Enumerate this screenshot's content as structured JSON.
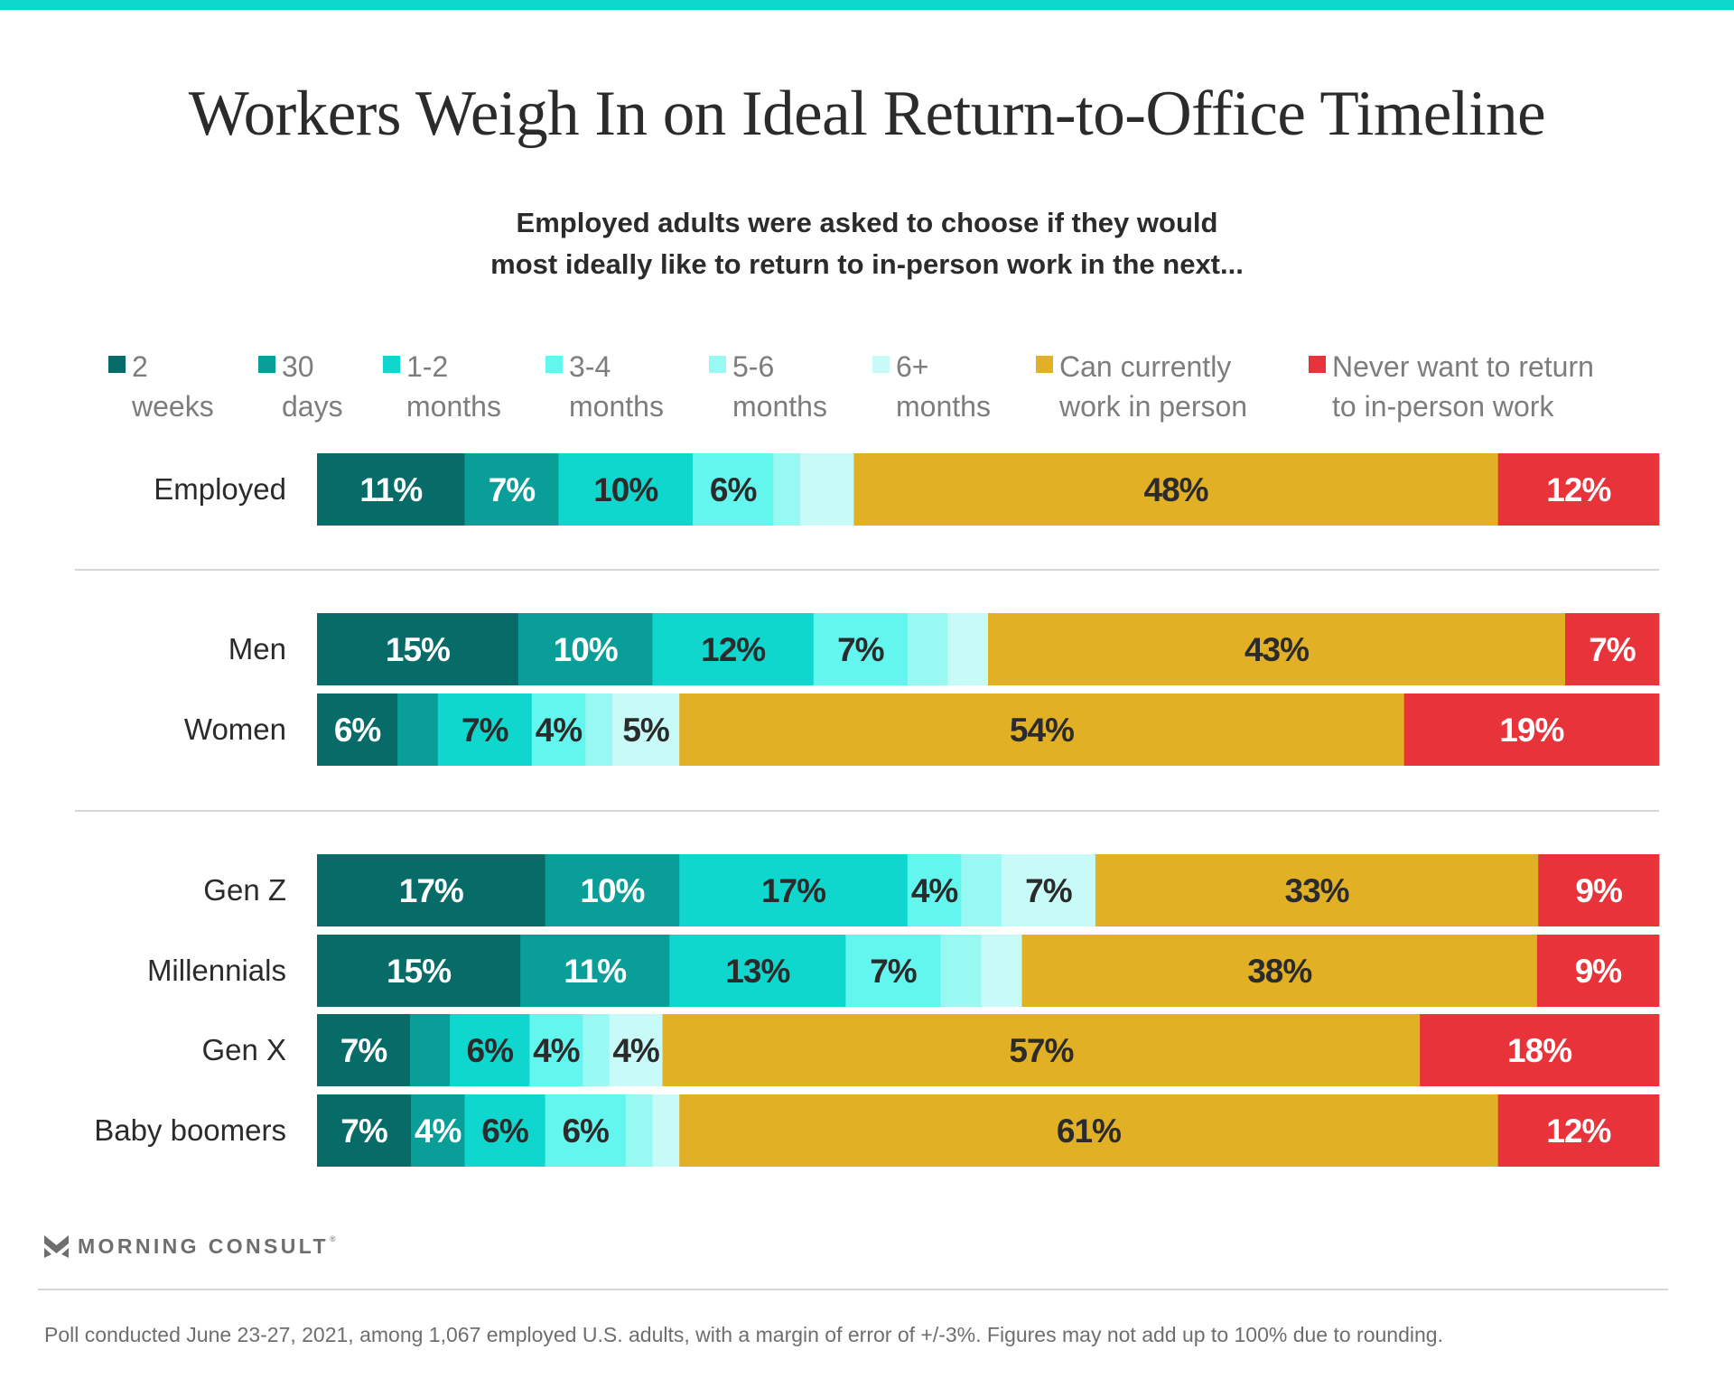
{
  "page": {
    "title": "Workers Weigh In on Ideal Return-to-Office Timeline",
    "subtitle_lines": [
      "Employed adults were asked to choose if they would",
      "most ideally like to return to in-person work in the next..."
    ],
    "brand": "MORNING CONSULT",
    "brand_mark": "®",
    "footnote": "Poll conducted June 23-27, 2021, among 1,067 employed U.S. adults, with a margin of error of +/-3%. Figures may not add up to 100% due to rounding.",
    "accent_color": "#0fd6cc"
  },
  "chart_data": {
    "type": "bar",
    "orientation": "horizontal",
    "stacked": true,
    "title": "Workers Weigh In on Ideal Return-to-Office Timeline",
    "subtitle": "Employed adults were asked to choose if they would most ideally like to return to in-person work in the next...",
    "xlabel": "",
    "ylabel": "",
    "units": "%",
    "xlim": [
      0,
      100
    ],
    "grid": false,
    "legend_position": "top",
    "categories": [
      "Employed",
      "Men",
      "Women",
      "Gen Z",
      "Millennials",
      "Gen X",
      "Baby boomers"
    ],
    "groups": [
      [
        "Employed"
      ],
      [
        "Men",
        "Women"
      ],
      [
        "Gen Z",
        "Millennials",
        "Gen X",
        "Baby boomers"
      ]
    ],
    "series": [
      {
        "name": "2 weeks",
        "legend_lines": [
          "2",
          "weeks"
        ],
        "color": "#076b67",
        "label_color": "#ffffff",
        "values": [
          11,
          15,
          6,
          17,
          15,
          7,
          7
        ],
        "labeled": [
          true,
          true,
          true,
          true,
          true,
          true,
          true
        ]
      },
      {
        "name": "30 days",
        "legend_lines": [
          "30",
          "days"
        ],
        "color": "#0a9e99",
        "label_color": "#ffffff",
        "values": [
          7,
          10,
          3,
          10,
          11,
          3,
          4
        ],
        "labeled": [
          true,
          true,
          false,
          true,
          true,
          false,
          true
        ]
      },
      {
        "name": "1-2 months",
        "legend_lines": [
          "1-2",
          "months"
        ],
        "color": "#0fd7ce",
        "label_color": "#2b2b2b",
        "values": [
          10,
          12,
          7,
          17,
          13,
          6,
          6
        ],
        "labeled": [
          true,
          true,
          true,
          true,
          true,
          true,
          true
        ]
      },
      {
        "name": "3-4 months",
        "legend_lines": [
          "3-4",
          "months"
        ],
        "color": "#62f6ee",
        "label_color": "#2b2b2b",
        "values": [
          6,
          7,
          4,
          4,
          7,
          4,
          6
        ],
        "labeled": [
          true,
          true,
          true,
          true,
          true,
          true,
          true
        ]
      },
      {
        "name": "5-6 months",
        "legend_lines": [
          "5-6",
          "months"
        ],
        "color": "#98f9f3",
        "label_color": "#2b2b2b",
        "values": [
          2,
          3,
          2,
          3,
          3,
          2,
          2
        ],
        "labeled": [
          false,
          false,
          false,
          false,
          false,
          false,
          false
        ]
      },
      {
        "name": "6+ months",
        "legend_lines": [
          "6+",
          "months"
        ],
        "color": "#c8fbf7",
        "label_color": "#2b2b2b",
        "values": [
          4,
          3,
          5,
          7,
          3,
          4,
          2
        ],
        "labeled": [
          false,
          false,
          true,
          true,
          false,
          true,
          false
        ]
      },
      {
        "name": "Can currently work in person",
        "legend_lines": [
          "Can currently",
          "work in person"
        ],
        "color": "#e1b024",
        "label_color": "#2b2b2b",
        "values": [
          48,
          43,
          54,
          33,
          38,
          57,
          61
        ],
        "labeled": [
          true,
          true,
          true,
          true,
          true,
          true,
          true
        ]
      },
      {
        "name": "Never want to return to in-person work",
        "legend_lines": [
          "Never want to return",
          "to in-person work"
        ],
        "color": "#e8333a",
        "label_color": "#ffffff",
        "values": [
          12,
          7,
          19,
          9,
          9,
          18,
          12
        ],
        "labeled": [
          true,
          true,
          true,
          true,
          true,
          true,
          true
        ]
      }
    ]
  }
}
